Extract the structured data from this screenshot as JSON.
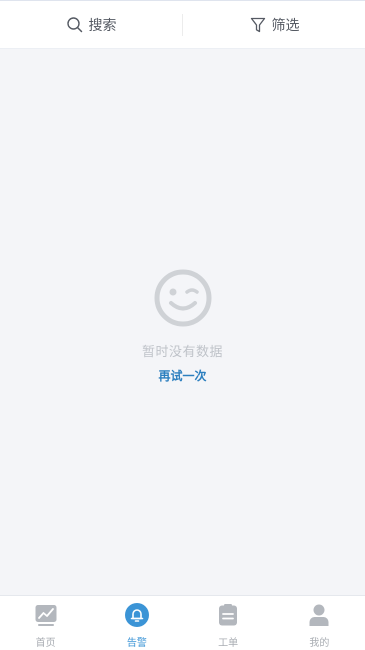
{
  "toolbar": {
    "search_label": "搜索",
    "filter_label": "筛选"
  },
  "empty_state": {
    "message": "暂时没有数据",
    "retry_label": "再试一次"
  },
  "bottom_nav": {
    "items": [
      {
        "label": "首页",
        "icon": "trend-chart-icon",
        "active": false
      },
      {
        "label": "告警",
        "icon": "bell-icon",
        "active": true
      },
      {
        "label": "工单",
        "icon": "clipboard-icon",
        "active": false
      },
      {
        "label": "我的",
        "icon": "user-icon",
        "active": false
      }
    ]
  },
  "colors": {
    "accent": "#3b94d6",
    "retry": "#2c7fbf",
    "inactive": "#a9adb3",
    "background": "#f4f5f8"
  }
}
